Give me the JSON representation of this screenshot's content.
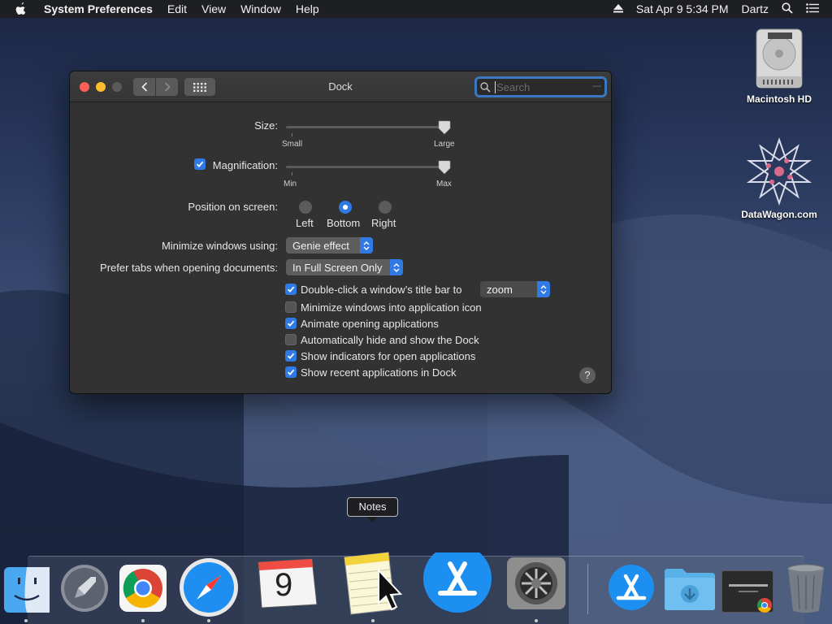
{
  "menubar": {
    "app_name": "System Preferences",
    "menus": [
      "Edit",
      "View",
      "Window",
      "Help"
    ],
    "date_time": "Sat Apr 9  5:34 PM",
    "user": "Dartz"
  },
  "window": {
    "title": "Dock",
    "search_placeholder": "Search",
    "size": {
      "label": "Size:",
      "min_label": "Small",
      "max_label": "Large",
      "value_fraction": 1.0
    },
    "magnification": {
      "label": "Magnification:",
      "checked": true,
      "min_label": "Min",
      "max_label": "Max",
      "value_fraction": 1.0
    },
    "position": {
      "label": "Position on screen:",
      "options": [
        "Left",
        "Bottom",
        "Right"
      ],
      "selected": "Bottom"
    },
    "minimize": {
      "label": "Minimize windows using:",
      "value": "Genie effect"
    },
    "prefer_tabs": {
      "label": "Prefer tabs when opening documents:",
      "value": "In Full Screen Only"
    },
    "double_click": {
      "label": "Double-click a window’s title bar to",
      "checked": true,
      "value": "zoom"
    },
    "checkboxes": [
      {
        "label": "Minimize windows into application icon",
        "checked": false
      },
      {
        "label": "Animate opening applications",
        "checked": true
      },
      {
        "label": "Automatically hide and show the Dock",
        "checked": false
      },
      {
        "label": "Show indicators for open applications",
        "checked": true
      },
      {
        "label": "Show recent applications in Dock",
        "checked": true
      }
    ],
    "help": "?"
  },
  "desktop": {
    "icons": [
      {
        "name": "Macintosh HD"
      },
      {
        "name": "DataWagon.com"
      }
    ]
  },
  "tooltip": "Notes",
  "calendar_day": "9",
  "dock_apps": [
    "Finder",
    "Launchpad",
    "Google Chrome",
    "Safari",
    "Calendar",
    "Notes",
    "App Store",
    "System Preferences",
    "App Store",
    "Downloads",
    "Google Chrome",
    "Trash"
  ]
}
